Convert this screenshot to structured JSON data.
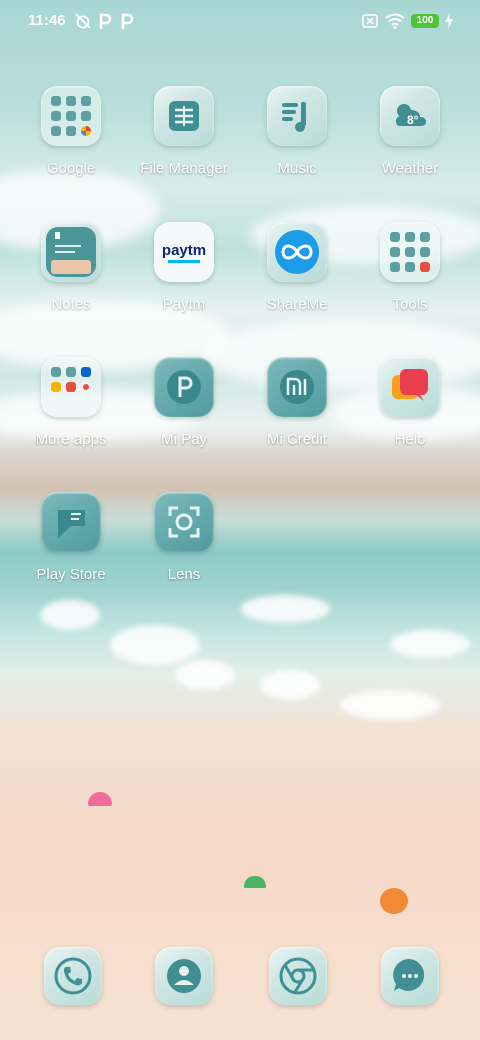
{
  "status_bar": {
    "time": "11:46",
    "battery": "100",
    "icons": [
      "alarm-off-icon",
      "paytm-notification-icon",
      "paytm-notification-icon",
      "sim-off-icon",
      "wifi-icon",
      "battery-icon",
      "charging-icon"
    ]
  },
  "apps": {
    "google": "Google",
    "file_manager": "File Manager",
    "music": "Music",
    "weather": "Weather",
    "weather_temp": "8°",
    "notes": "Notes",
    "paytm": "Paytm",
    "paytm_logo": "paytm",
    "shareme": "ShareMe",
    "tools": "Tools",
    "more_apps": "More apps",
    "mi_pay": "Mi Pay",
    "mi_credit": "Mi Credit",
    "helo": "Helo",
    "play_store": "Play Store",
    "lens": "Lens"
  },
  "dock": {
    "icons": [
      "phone-icon",
      "contacts-icon",
      "chrome-icon",
      "messages-icon"
    ]
  },
  "colors": {
    "icon_teal": "#3f8f93",
    "label": "#ffffff",
    "battery": "#4fc43a"
  }
}
